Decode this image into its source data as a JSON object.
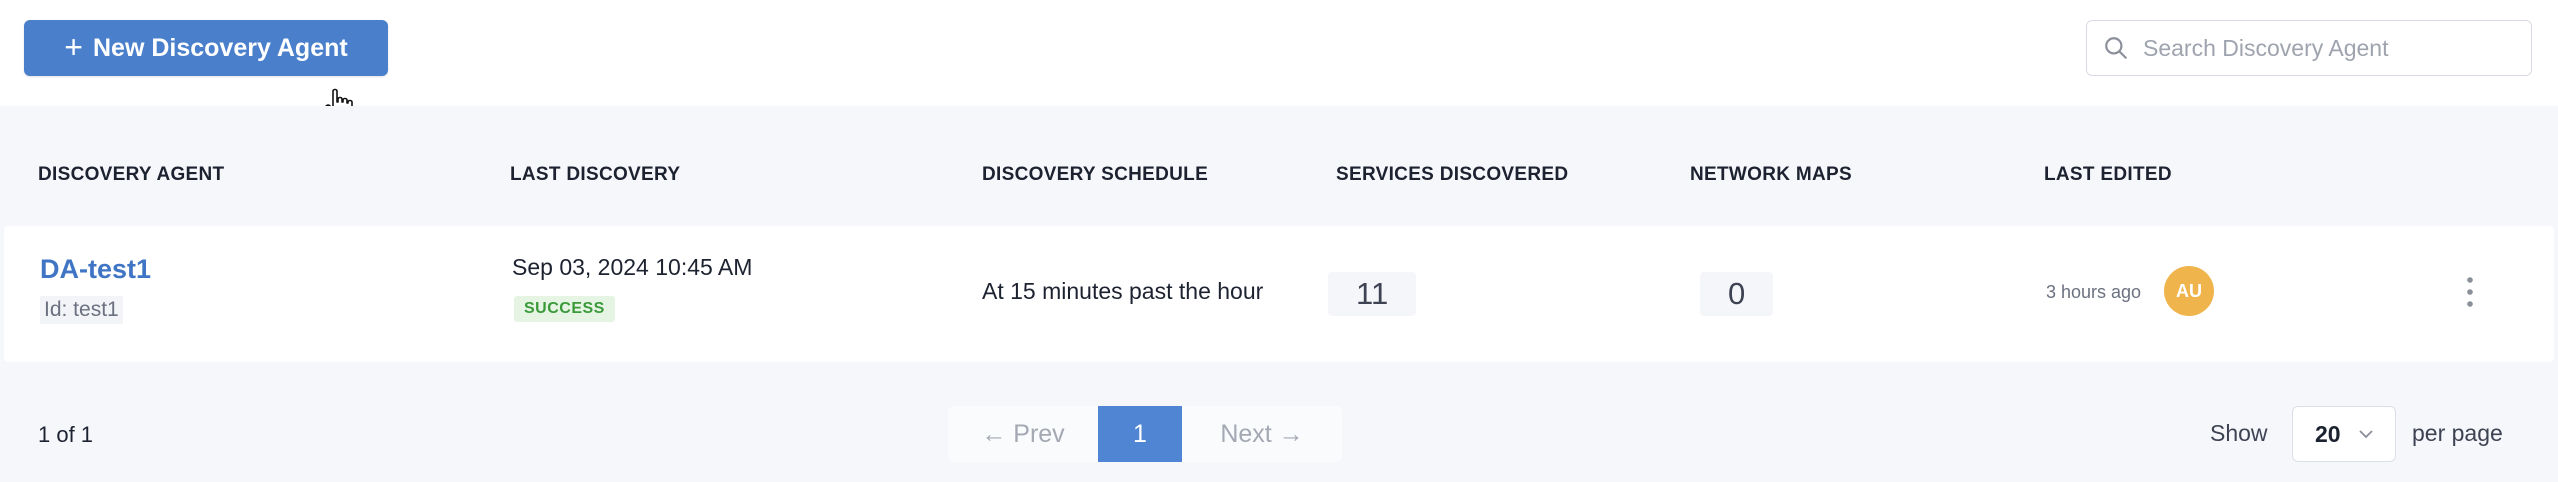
{
  "toolbar": {
    "new_button_label": "New Discovery Agent",
    "search_placeholder": "Search Discovery Agent"
  },
  "table": {
    "columns": [
      "DISCOVERY AGENT",
      "LAST DISCOVERY",
      "DISCOVERY SCHEDULE",
      "SERVICES DISCOVERED",
      "NETWORK MAPS",
      "LAST EDITED"
    ],
    "rows": [
      {
        "name": "DA-test1",
        "id_text": "Id: test1",
        "last_discovery": "Sep 03, 2024 10:45 AM",
        "status": "SUCCESS",
        "schedule": "At 15 minutes past the hour",
        "services_discovered": "11",
        "network_maps": "0",
        "last_edited": "3 hours ago",
        "avatar_initials": "AU"
      }
    ]
  },
  "footer": {
    "count_text": "1 of 1",
    "prev_label": "Prev",
    "next_label": "Next",
    "current_page": "1",
    "show_label": "Show",
    "per_page_value": "20",
    "per_page_label": "per page"
  },
  "colors": {
    "primary": "#4a7fcb",
    "link": "#3f75c4",
    "success_text": "#3a9a3a",
    "success_bg": "#e6f4e4",
    "avatar": "#f0b44c"
  }
}
